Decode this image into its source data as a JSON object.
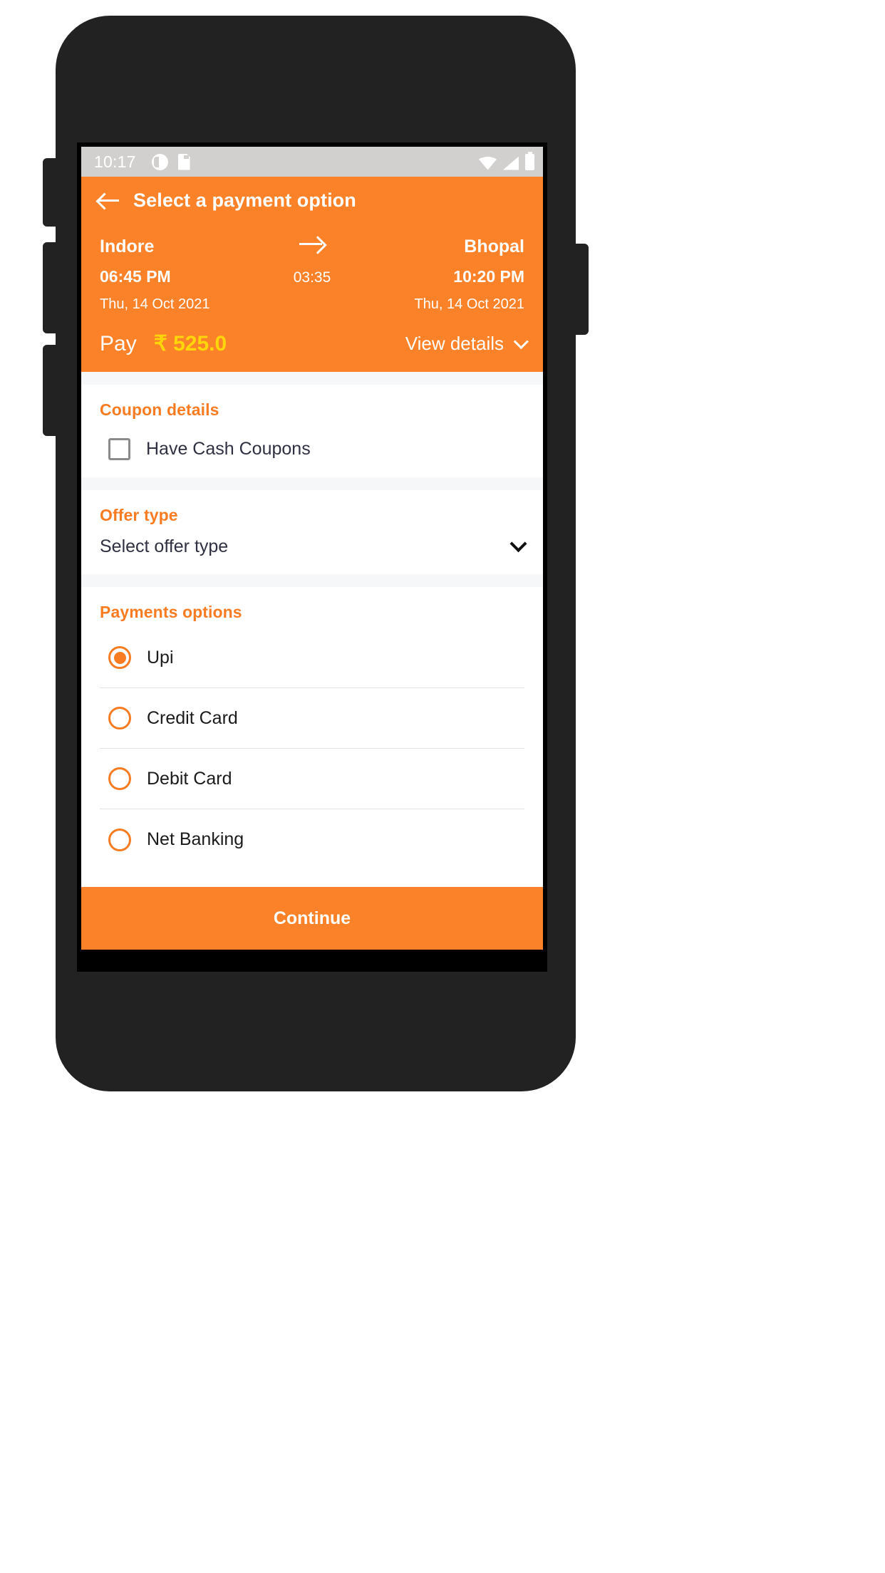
{
  "status_bar": {
    "time": "10:17",
    "left_icons": [
      "dnd-icon",
      "sd-card-icon"
    ],
    "right_icons": [
      "wifi-icon",
      "signal-icon",
      "battery-icon"
    ]
  },
  "header": {
    "back_icon": "back-arrow-icon",
    "title": "Select a payment option",
    "accent_color": "#fb8229"
  },
  "journey": {
    "origin": "Indore",
    "destination": "Bhopal",
    "arrow_icon": "arrow-right-icon",
    "departure_time": "06:45 PM",
    "arrival_time": "10:20 PM",
    "duration": "03:35",
    "departure_date": "Thu, 14 Oct 2021",
    "arrival_date": "Thu, 14 Oct 2021"
  },
  "pay": {
    "label": "Pay",
    "amount": "₹ 525.0",
    "amount_color": "#ffd60a",
    "view_details_label": "View details",
    "chevron_icon": "chevron-down-icon"
  },
  "coupon": {
    "title": "Coupon details",
    "checkbox_label": "Have Cash Coupons",
    "checked": false
  },
  "offer": {
    "title": "Offer type",
    "selected_value": "Select offer type",
    "chevron_icon": "chevron-down-icon"
  },
  "payments": {
    "title": "Payments options",
    "selected": "Upi",
    "options": [
      {
        "label": "Upi",
        "selected": true
      },
      {
        "label": "Credit Card",
        "selected": false
      },
      {
        "label": "Debit Card",
        "selected": false
      },
      {
        "label": "Net Banking",
        "selected": false
      }
    ]
  },
  "footer": {
    "continue_label": "Continue"
  },
  "navbar": {
    "back_icon": "nav-back-icon",
    "home_icon": "nav-home-icon",
    "recents_icon": "nav-recents-icon"
  }
}
